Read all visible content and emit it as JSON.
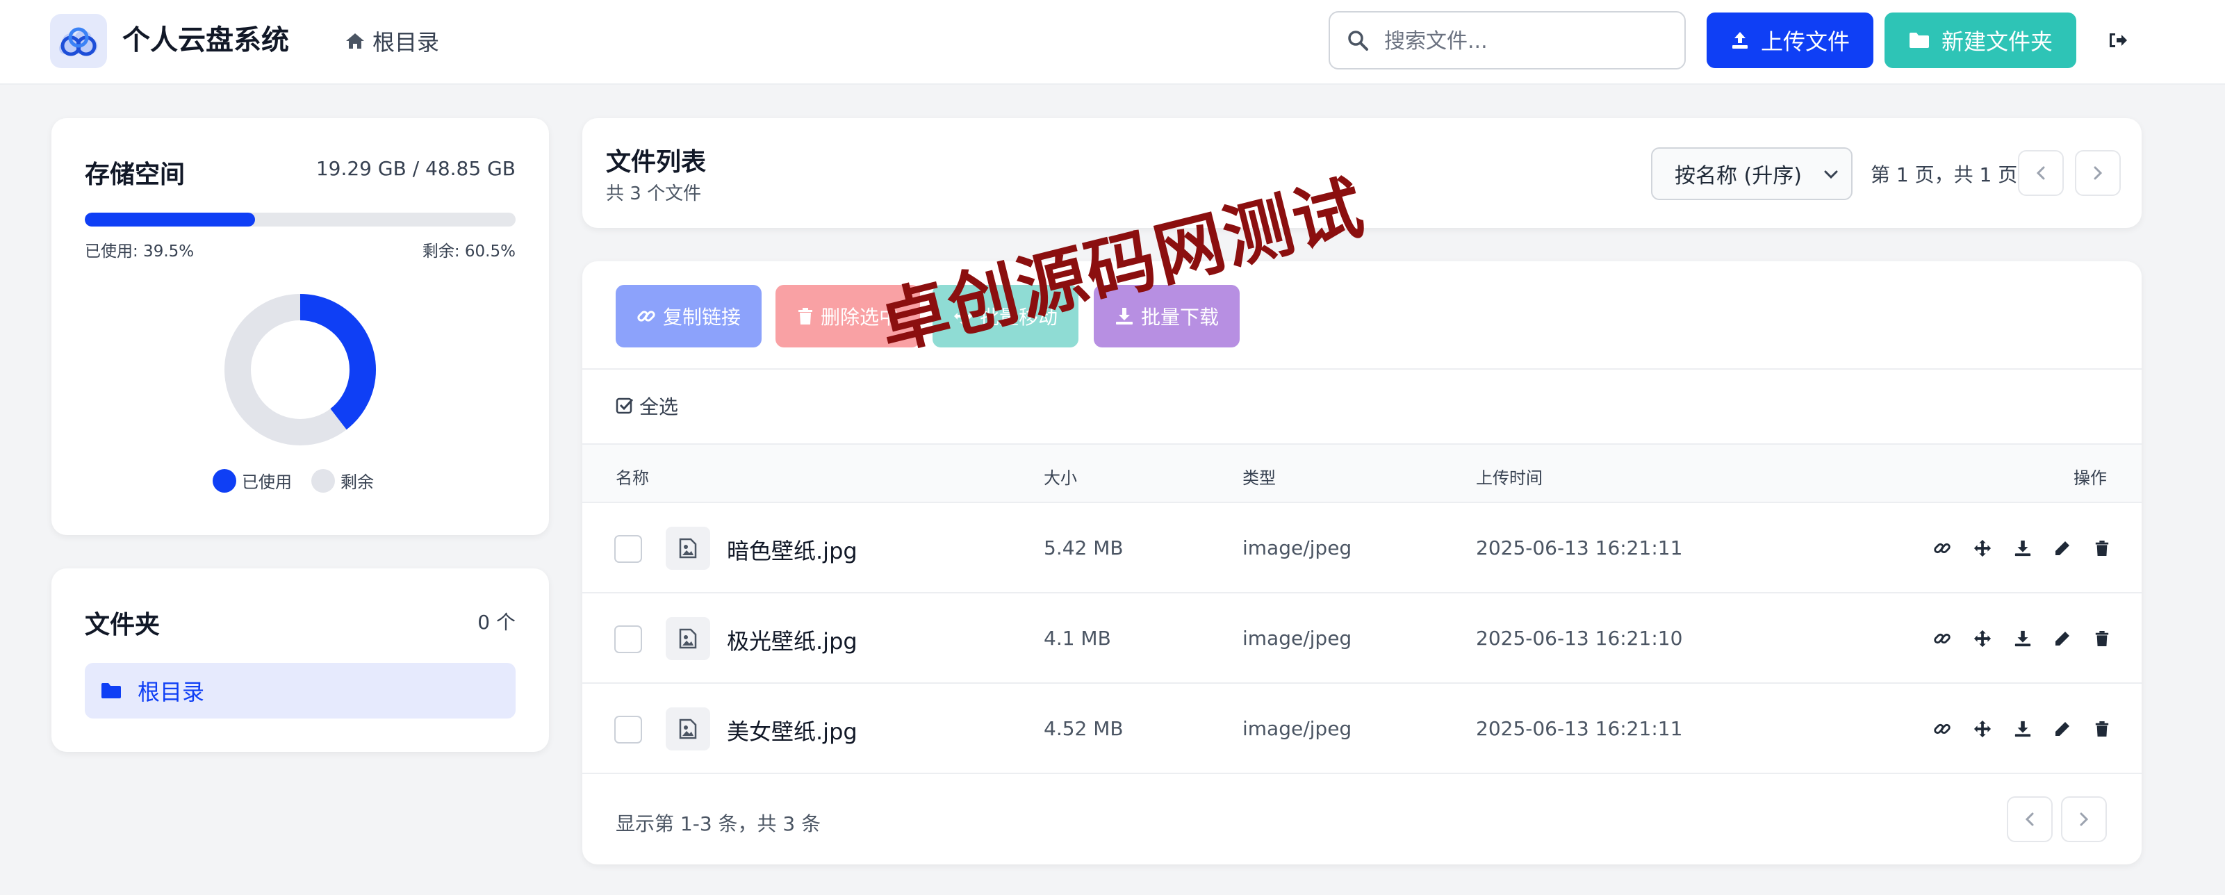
{
  "header": {
    "app_title": "个人云盘系统",
    "breadcrumb": "根目录",
    "search_placeholder": "搜索文件...",
    "upload_label": "上传文件",
    "new_folder_label": "新建文件夹"
  },
  "storage": {
    "title": "存储空间",
    "amount": "19.29 GB / 48.85 GB",
    "used_fraction": 0.395,
    "used_label": "已使用: 39.5%",
    "free_label": "剩余: 60.5%",
    "legend_used": "已使用",
    "legend_free": "剩余",
    "used_color": "#0f3ff5",
    "free_color": "#e2e4ea"
  },
  "folders": {
    "title": "文件夹",
    "count": "0 个",
    "items": [
      "根目录"
    ]
  },
  "file_list": {
    "title": "文件列表",
    "subtitle": "共 3 个文件",
    "sort_selected": "按名称 (升序)",
    "page_info": "第 1 页，共 1 页"
  },
  "actions": {
    "copy_link": "复制链接",
    "delete_selected": "删除选中",
    "batch_move": "批量移动",
    "batch_download": "批量下载",
    "select_all": "全选"
  },
  "table": {
    "columns": {
      "name": "名称",
      "size": "大小",
      "type": "类型",
      "uploaded": "上传时间",
      "ops": "操作"
    },
    "rows": [
      {
        "name": "暗色壁纸.jpg",
        "size": "5.42 MB",
        "type": "image/jpeg",
        "uploaded": "2025-06-13 16:21:11"
      },
      {
        "name": "极光壁纸.jpg",
        "size": "4.1 MB",
        "type": "image/jpeg",
        "uploaded": "2025-06-13 16:21:10"
      },
      {
        "name": "美女壁纸.jpg",
        "size": "4.52 MB",
        "type": "image/jpeg",
        "uploaded": "2025-06-13 16:21:11"
      }
    ],
    "row_op_icons": [
      "link-icon",
      "move-icon",
      "download-icon",
      "edit-icon",
      "trash-icon"
    ]
  },
  "footer": {
    "summary": "显示第 1-3 条，共 3 条"
  },
  "watermark": "卓创源码网测试"
}
